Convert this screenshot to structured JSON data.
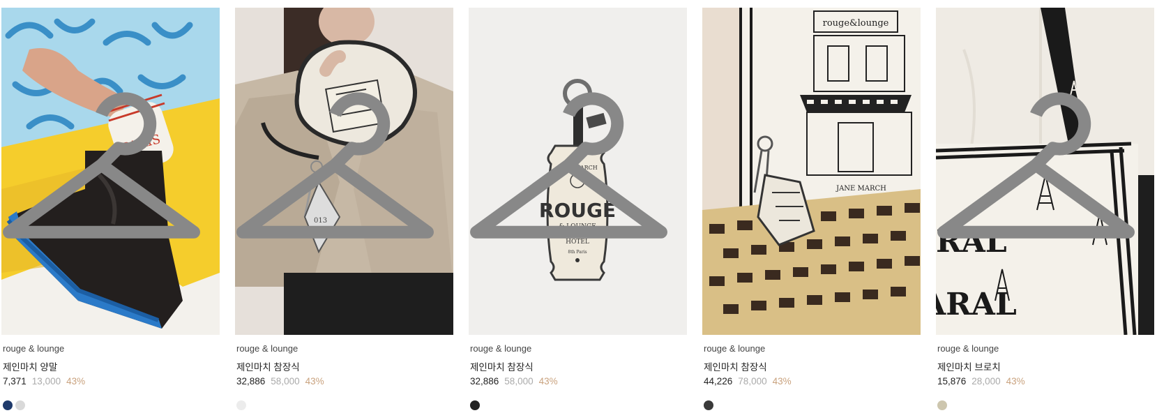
{
  "products": [
    {
      "brand": "rouge & lounge",
      "name": "제인마치 양말",
      "price": "7,371",
      "original_price": "13,000",
      "discount": "43%",
      "swatches": [
        "#1f3a6b",
        "#d9d9d9"
      ],
      "image_icon": "hanger-icon"
    },
    {
      "brand": "rouge & lounge",
      "name": "제인마치 참장식",
      "price": "32,886",
      "original_price": "58,000",
      "discount": "43%",
      "swatches": [
        "#ececec"
      ],
      "image_icon": "hanger-icon"
    },
    {
      "brand": "rouge & lounge",
      "name": "제인마치 참장식",
      "price": "32,886",
      "original_price": "58,000",
      "discount": "43%",
      "swatches": [
        "#222222"
      ],
      "image_icon": "hanger-icon"
    },
    {
      "brand": "rouge & lounge",
      "name": "제인마치 참장식",
      "price": "44,226",
      "original_price": "78,000",
      "discount": "43%",
      "swatches": [
        "#3a3a3a"
      ],
      "image_icon": "hanger-icon"
    },
    {
      "brand": "rouge & lounge",
      "name": "제인마치 브로치",
      "price": "15,876",
      "original_price": "28,000",
      "discount": "43%",
      "swatches": [
        "#cdc6ae"
      ],
      "image_icon": "hanger-icon"
    }
  ],
  "image_texts": {
    "socks": "PARIS",
    "keychain_top": "JANE MARCH",
    "keychain_main": "ROUGE",
    "keychain_sub1": "& LOUNGE",
    "keychain_sub2": "LE",
    "keychain_sub3": "HOTEL",
    "keychain_bottom": "8th Paris",
    "pouch_tag": "013",
    "bag_sign": "rouge&lounge",
    "bag_signature": "JANE MARCH",
    "tote_text_row1": "RAL",
    "tote_text_row2": "ARAL"
  }
}
